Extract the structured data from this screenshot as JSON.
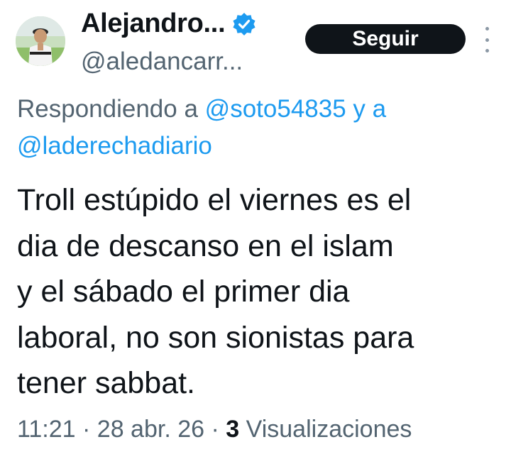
{
  "author": {
    "display_name": "Alejandro...",
    "handle": "@aledancarr...",
    "verified": true
  },
  "follow_button": {
    "label": "Seguir"
  },
  "more_menu_icon": "more-vertical-icon",
  "reply_context": {
    "prefix": "Respondiendo a",
    "mention_1": "@soto54835",
    "conjunction": "y a",
    "mention_2": "@laderechadiario"
  },
  "tweet": {
    "lines": [
      "Troll estúpido el viernes es el",
      "dia de descanso en el islam",
      "y el sábado el primer dia",
      "laboral, no son sionistas para",
      "tener sabbat."
    ]
  },
  "meta": {
    "time": "11:21",
    "date": "28 abr. 26",
    "separator": "·",
    "views_count": "3",
    "views_label": "Visualizaciones"
  },
  "colors": {
    "mention": "#1d9bf0",
    "secondary_text": "#536471",
    "primary_text": "#0f1419",
    "verified_badge": "#1d9bf0",
    "follow_button_bg": "#0f1419"
  }
}
